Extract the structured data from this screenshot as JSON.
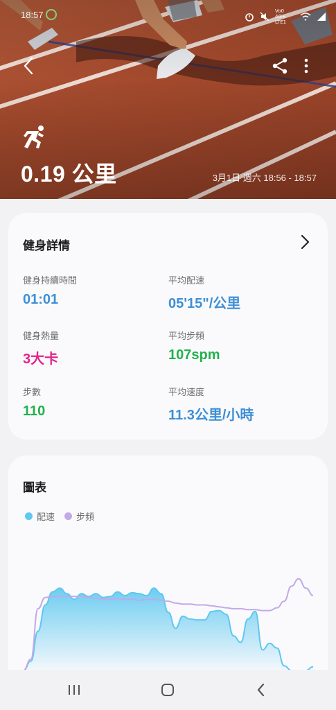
{
  "status_bar": {
    "time": "18:57",
    "network_label": "Vo0 4G+ LTE1",
    "icons": [
      "alarm-icon",
      "mute-icon",
      "wifi-icon",
      "signal-icon"
    ]
  },
  "header": {
    "distance": "0.19 公里",
    "datetime": "3月1日 週六 18:56 - 18:57"
  },
  "details": {
    "title": "健身詳情",
    "metrics": [
      {
        "label": "健身持續時間",
        "value": "01:01",
        "color": "#3e8fd6"
      },
      {
        "label": "平均配速",
        "value": "05'15\"/公里",
        "color": "#3e8fd6"
      },
      {
        "label": "健身熱量",
        "value": "3大卡",
        "color": "#e2248b"
      },
      {
        "label": "平均步頻",
        "value": "107spm",
        "color": "#23b14d"
      },
      {
        "label": "步數",
        "value": "110",
        "color": "#23b14d"
      },
      {
        "label": "平均速度",
        "value": "11.3公里/小時",
        "color": "#3e8fd6"
      }
    ]
  },
  "chart": {
    "title": "圖表",
    "legend": [
      {
        "name": "配速",
        "color": "#5ec8f0"
      },
      {
        "name": "步頻",
        "color": "#c2a9e8"
      }
    ]
  },
  "chart_data": {
    "type": "area",
    "series": [
      {
        "name": "配速",
        "color": "#5ec8f0",
        "values": [
          0,
          10,
          42,
          70,
          84,
          88,
          82,
          76,
          82,
          79,
          82,
          78,
          79,
          84,
          80,
          83,
          82,
          80,
          88,
          82,
          62,
          45,
          58,
          55,
          54,
          54,
          63,
          64,
          60,
          37,
          30,
          55,
          63,
          22,
          29,
          24,
          5,
          0,
          0,
          0,
          4
        ]
      },
      {
        "name": "步頻",
        "color": "#c2a9e8",
        "values": [
          0,
          12,
          66,
          78,
          79,
          79,
          79,
          79,
          79,
          78,
          77,
          76,
          76,
          77,
          76,
          76,
          75,
          76,
          76,
          75,
          74,
          72,
          71,
          71,
          70,
          70,
          69,
          68,
          67,
          66,
          66,
          65,
          65,
          64,
          64,
          67,
          74,
          90,
          98,
          88,
          80
        ]
      }
    ]
  },
  "nav": {
    "icons": [
      "recent-apps-icon",
      "home-icon",
      "back-icon"
    ]
  }
}
